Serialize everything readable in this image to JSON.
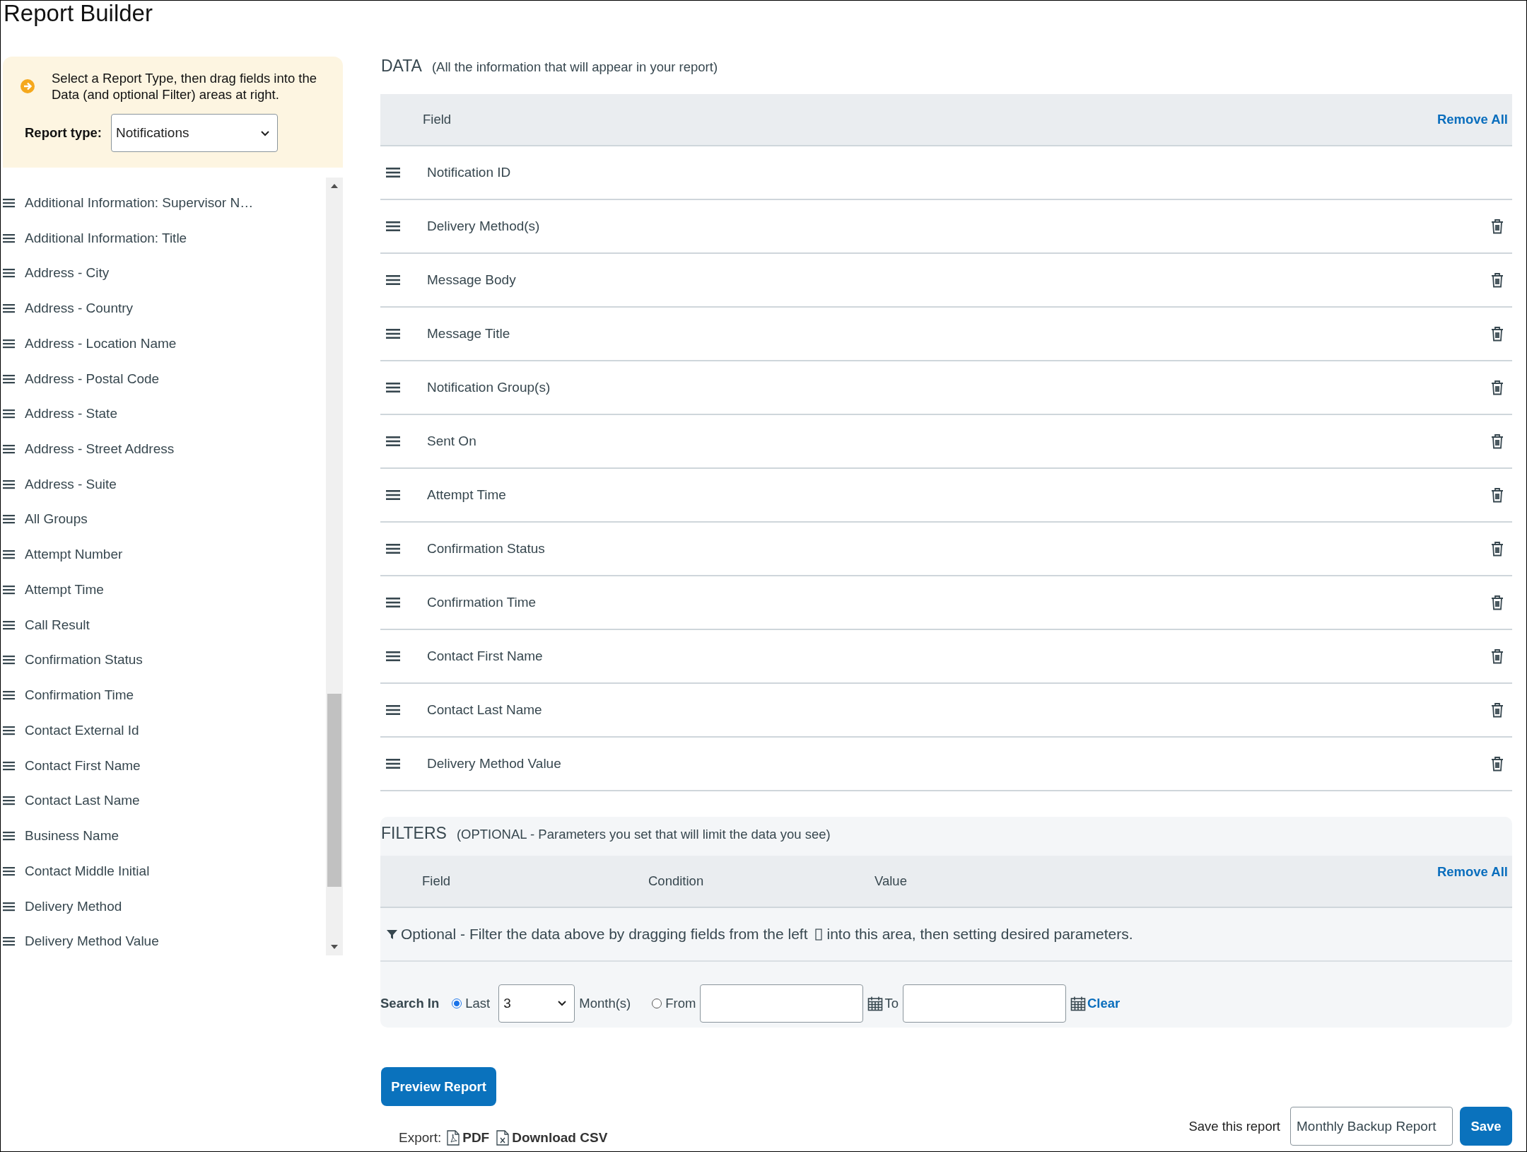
{
  "page": {
    "title": "Report Builder"
  },
  "sidebar": {
    "hint": "Select a Report Type, then drag fields into the Data (and optional Filter) areas at right.",
    "report_type": {
      "label": "Report type:",
      "value": "Notifications"
    },
    "fields": [
      "Additional Information: Supervisor N…",
      "Additional Information: Title",
      "Address - City",
      "Address - Country",
      "Address - Location Name",
      "Address - Postal Code",
      "Address - State",
      "Address - Street Address",
      "Address - Suite",
      "All Groups",
      "Attempt Number",
      "Attempt Time",
      "Call Result",
      "Confirmation Status",
      "Confirmation Time",
      "Contact External Id",
      "Contact First Name",
      "Contact Last Name",
      "Business Name",
      "Contact Middle Initial",
      "Delivery Method",
      "Delivery Method Value"
    ]
  },
  "data": {
    "heading": "DATA",
    "subheading": "(All the information that will appear in your report)",
    "columns": [
      "Field"
    ],
    "remove_all": "Remove All",
    "rows": [
      {
        "field": "Notification ID",
        "removable": false
      },
      {
        "field": "Delivery Method(s)",
        "removable": true
      },
      {
        "field": "Message Body",
        "removable": true
      },
      {
        "field": "Message Title",
        "removable": true
      },
      {
        "field": "Notification Group(s)",
        "removable": true
      },
      {
        "field": "Sent On",
        "removable": true
      },
      {
        "field": "Attempt Time",
        "removable": true
      },
      {
        "field": "Confirmation Status",
        "removable": true
      },
      {
        "field": "Confirmation Time",
        "removable": true
      },
      {
        "field": "Contact First Name",
        "removable": true
      },
      {
        "field": "Contact Last Name",
        "removable": true
      },
      {
        "field": "Delivery Method Value",
        "removable": true
      }
    ]
  },
  "filters": {
    "heading": "FILTERS",
    "subheading": "(OPTIONAL - Parameters you set that will limit the data you see)",
    "columns": [
      "Field",
      "Condition",
      "Value"
    ],
    "remove_all": "Remove All",
    "hint_parts": [
      "Optional - Filter the data above by dragging fields from the left",
      "into this area, then setting desired parameters."
    ],
    "search_in": {
      "label": "Search In",
      "options": [
        {
          "label": "Last",
          "selected": true
        },
        {
          "label": "From",
          "selected": false
        }
      ],
      "last_value": "3",
      "unit": "Month(s)",
      "to_label": "To",
      "clear": "Clear"
    }
  },
  "actions": {
    "preview": "Preview Report",
    "export_label": "Export:",
    "exports": [
      {
        "kind": "pdf",
        "label": "PDF"
      },
      {
        "kind": "csv",
        "label": "Download CSV"
      }
    ],
    "save_label": "Save this report",
    "save_name": "Monthly Backup Report",
    "save": "Save"
  }
}
